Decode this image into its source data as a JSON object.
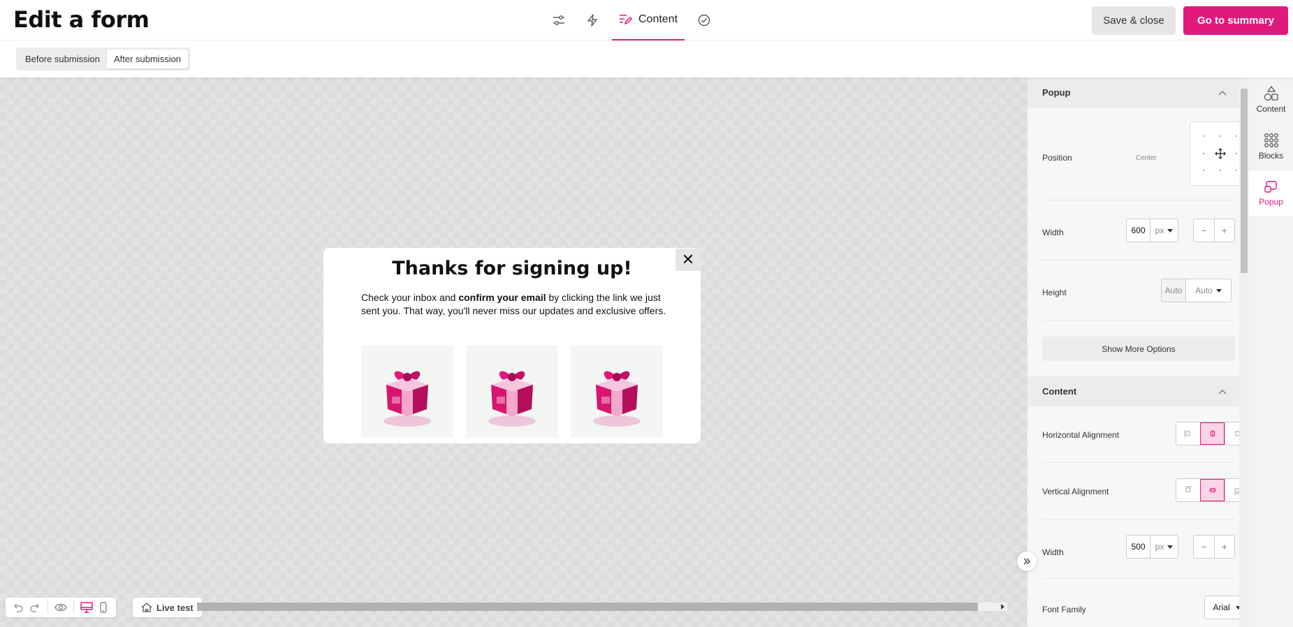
{
  "header": {
    "title": "Edit a form",
    "steps": [
      {
        "icon": "sliders-icon"
      },
      {
        "icon": "lightning-icon"
      },
      {
        "icon": "content-edit-icon",
        "label": "Content",
        "active": true
      },
      {
        "icon": "check-circle-icon"
      }
    ],
    "save_label": "Save & close",
    "summary_label": "Go to summary"
  },
  "submission_toggle": {
    "options": [
      "Before submission",
      "After submission"
    ],
    "selected": "After submission"
  },
  "popup_preview": {
    "close_glyph": "✕",
    "title": "Thanks for signing up!",
    "text_before": "Check your inbox and ",
    "text_bold": "confirm your email",
    "text_after": " by clicking the link we just sent you. That way, you'll never miss our updates and exclusive offers.",
    "images": [
      "gift-box-image",
      "gift-box-image",
      "gift-box-image"
    ]
  },
  "toolbar": {
    "icons": [
      "undo-icon",
      "redo-icon",
      "eye-icon",
      "desktop-icon",
      "mobile-icon"
    ],
    "live_test_label": "Live test"
  },
  "panel": {
    "popup_section": {
      "title": "Popup",
      "position_label": "Position",
      "position_value": "Center",
      "width_label": "Width",
      "width_value": "600",
      "width_unit": "px",
      "height_label": "Height",
      "height_value": "Auto",
      "height_mode": "Auto",
      "show_more_label": "Show More Options"
    },
    "content_section": {
      "title": "Content",
      "halign_label": "Horizontal Alignment",
      "halign_selected": "center",
      "valign_label": "Vertical Alignment",
      "valign_selected": "middle",
      "width_label": "Width",
      "width_value": "500",
      "width_unit": "px",
      "font_label": "Font Family",
      "font_value": "Arial"
    },
    "stepper_minus": "−",
    "stepper_plus": "+"
  },
  "rail": {
    "tabs": [
      {
        "label": "Content",
        "icon": "shapes-icon"
      },
      {
        "label": "Blocks",
        "icon": "grid-dots-icon"
      },
      {
        "label": "Popup",
        "icon": "popup-icon",
        "active": true
      }
    ]
  },
  "colors": {
    "accent": "#e0197d",
    "accent_light": "#fbd5e6"
  }
}
